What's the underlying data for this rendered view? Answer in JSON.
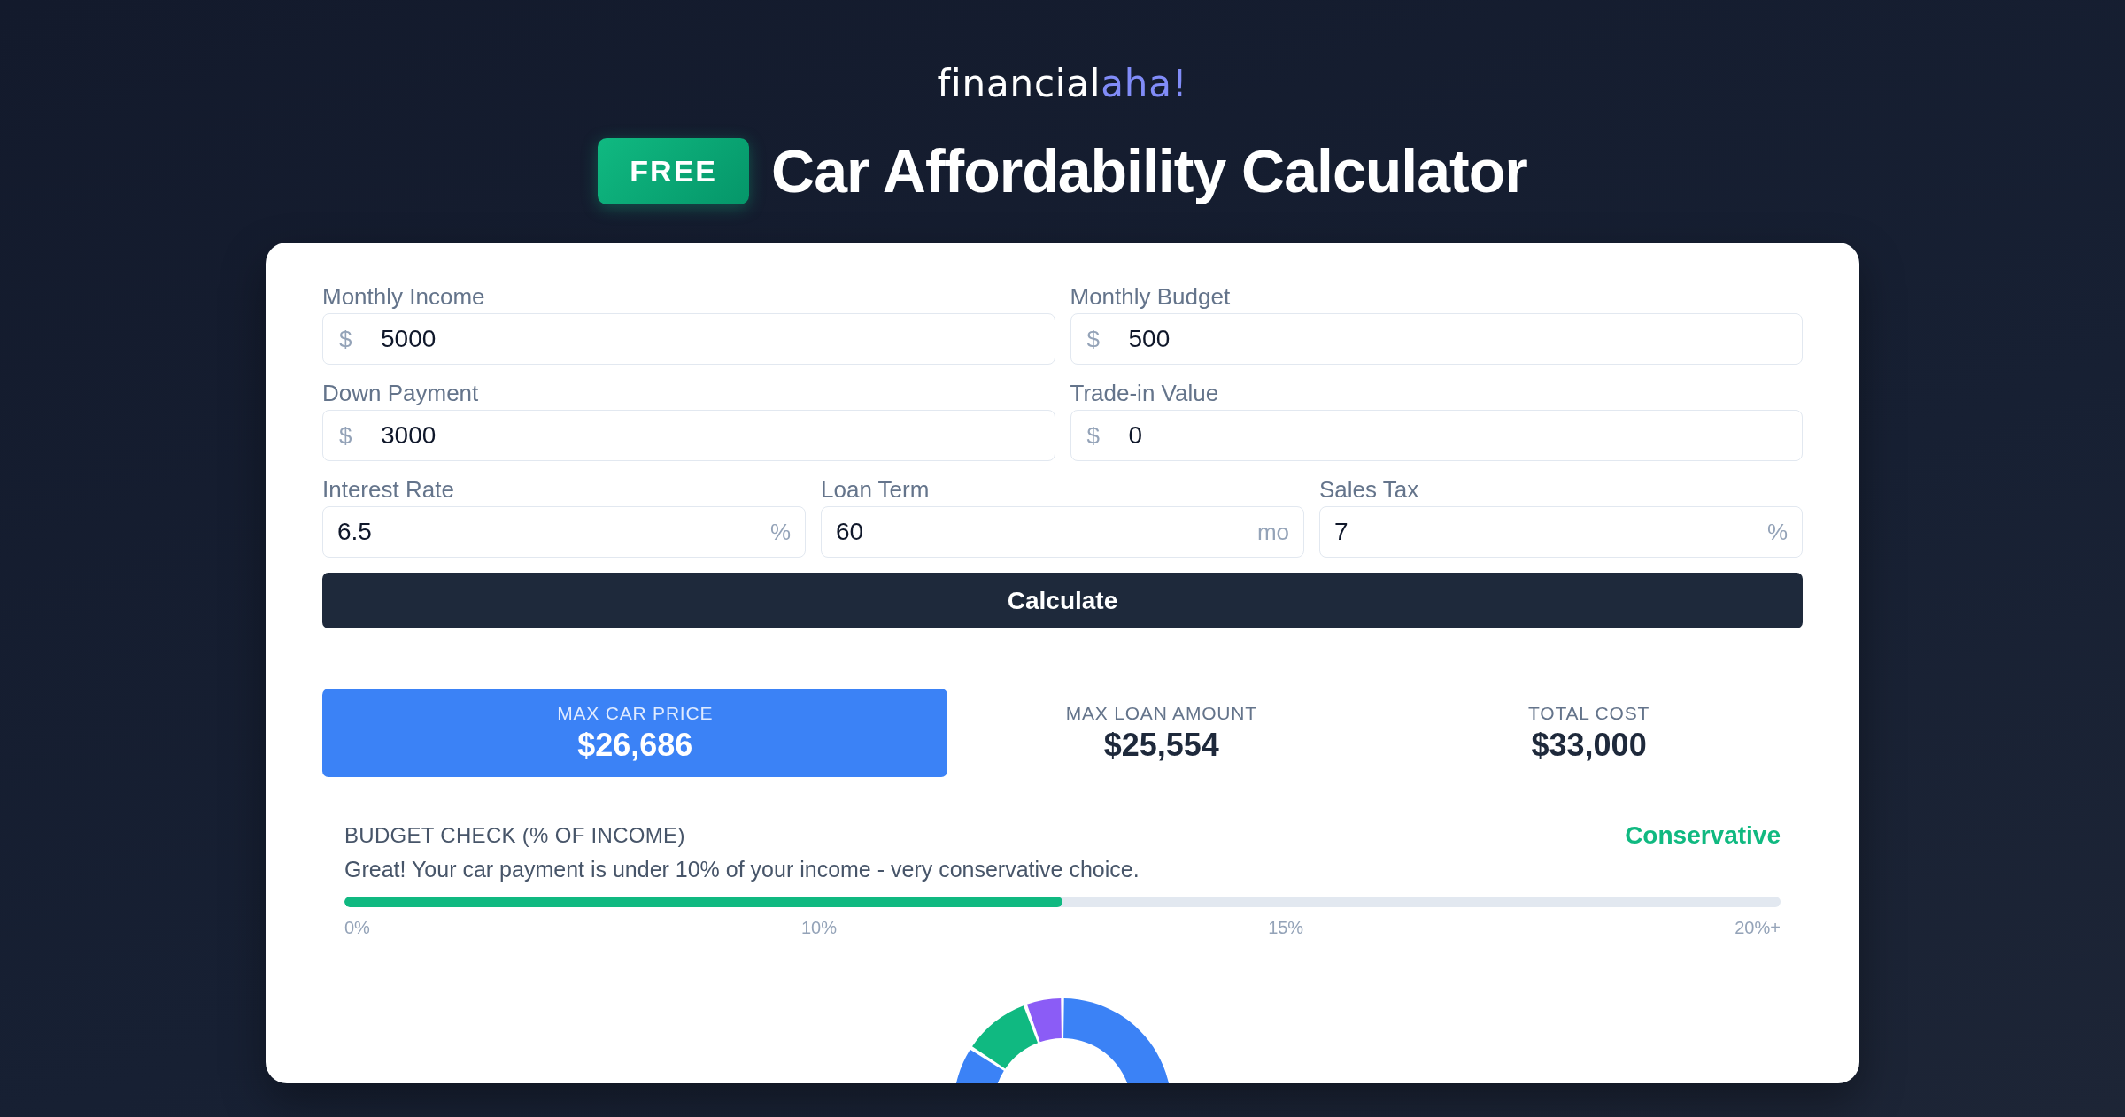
{
  "brand": {
    "name": "financial",
    "accent": "aha!"
  },
  "header": {
    "badge": "FREE",
    "title": "Car Affordability Calculator"
  },
  "form": {
    "rows": [
      [
        {
          "label": "Monthly Income",
          "unit": "$",
          "kind": "prefix",
          "value": "5000"
        },
        {
          "label": "Monthly Budget",
          "unit": "$",
          "kind": "prefix",
          "value": "500"
        }
      ],
      [
        {
          "label": "Down Payment",
          "unit": "$",
          "kind": "prefix",
          "value": "3000"
        },
        {
          "label": "Trade-in Value",
          "unit": "$",
          "kind": "prefix",
          "value": "0"
        }
      ],
      [
        {
          "label": "Interest Rate",
          "unit": "%",
          "kind": "suffix",
          "value": "6.5"
        },
        {
          "label": "Loan Term",
          "unit": "mo",
          "kind": "suffix",
          "value": "60"
        },
        {
          "label": "Sales Tax",
          "unit": "%",
          "kind": "suffix",
          "value": "7"
        }
      ]
    ],
    "button": "Calculate"
  },
  "results": [
    {
      "label": "MAX CAR PRICE",
      "value": "$26,686",
      "highlighted": true
    },
    {
      "label": "MAX LOAN AMOUNT",
      "value": "$25,554",
      "highlighted": false
    },
    {
      "label": "TOTAL COST",
      "value": "$33,000",
      "highlighted": false
    }
  ],
  "budget_check": {
    "title": "BUDGET CHECK (% OF INCOME)",
    "status": "Conservative",
    "message": "Great! Your car payment is under 10% of your income - very conservative choice.",
    "level": 0.5,
    "scale": [
      "0%",
      "10%",
      "15%",
      "20%+"
    ]
  }
}
